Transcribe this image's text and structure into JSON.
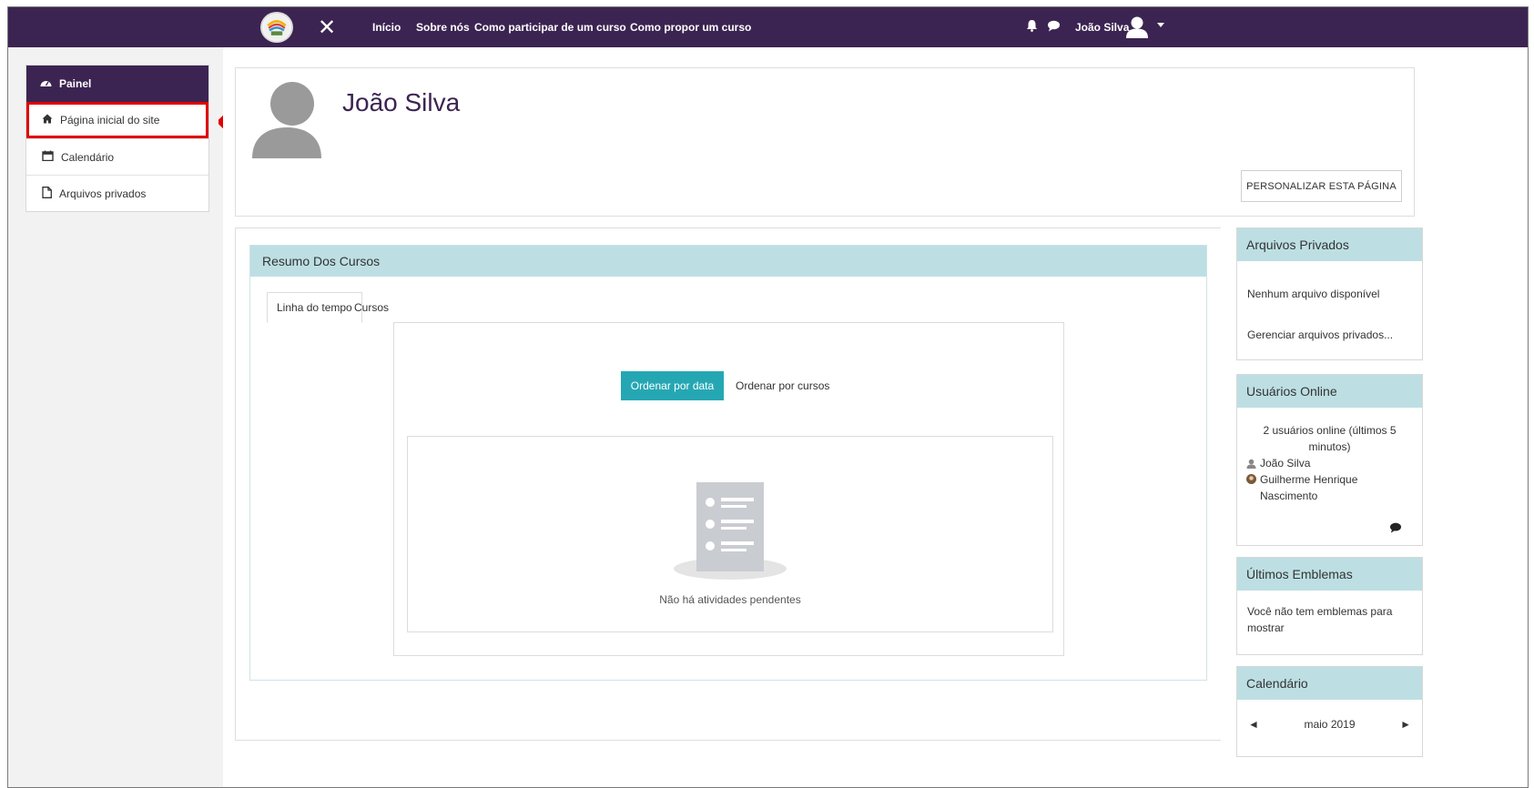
{
  "navbar": {
    "close_symbol": "✕",
    "links": [
      "Início",
      "Sobre nós",
      "Como participar de um curso",
      "Como propor um curso"
    ],
    "user_name": "João Silva",
    "icons": [
      "bell-icon",
      "chat-icon",
      "user-avatar-icon",
      "caret-down-icon"
    ],
    "background": "#3c2452"
  },
  "sidebar": {
    "header": "Painel",
    "items": [
      {
        "label": "Página inicial do site",
        "icon": "home-icon",
        "highlighted": true
      },
      {
        "label": "Calendário",
        "icon": "calendar-icon"
      },
      {
        "label": "Arquivos privados",
        "icon": "file-icon"
      }
    ]
  },
  "profile_header": {
    "name": "João Silva",
    "customize_label": "PERSONALIZAR ESTA PÁGINA"
  },
  "course_overview": {
    "title": "Resumo Dos Cursos",
    "tabs": [
      "Linha do tempo",
      "Cursos"
    ],
    "sort_by_date": "Ordenar por data",
    "sort_by_course": "Ordenar por cursos",
    "empty_message": "Não há atividades pendentes",
    "accent": "#25a7b3"
  },
  "private_files": {
    "title": "Arquivos Privados",
    "empty": "Nenhum arquivo disponível",
    "manage": "Gerenciar arquivos privados..."
  },
  "online_users": {
    "title": "Usuários Online",
    "summary": "2 usuários online (últimos 5 minutos)",
    "users": [
      "João Silva",
      "Guilherme Henrique Nascimento"
    ]
  },
  "badges": {
    "title": "Últimos Emblemas",
    "message": "Você não tem emblemas para mostrar"
  },
  "calendar": {
    "title": "Calendário",
    "month": "maio 2019",
    "prev_symbol": "◄",
    "next_symbol": "►"
  },
  "block_header_color": "#bddfe3"
}
